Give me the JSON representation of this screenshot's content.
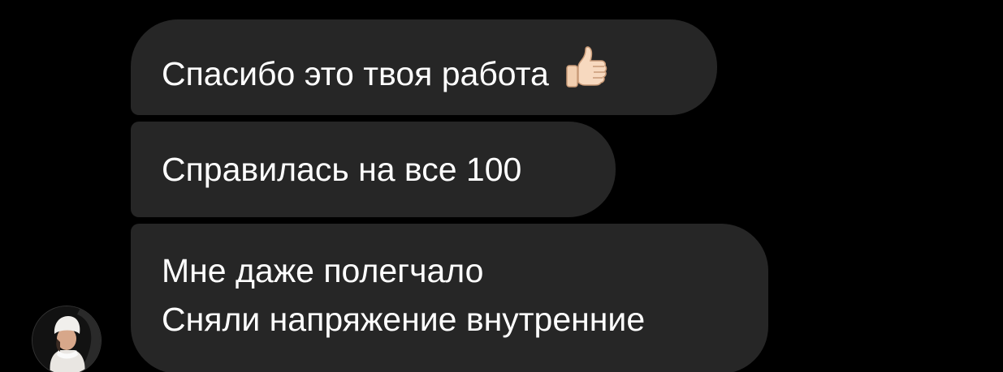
{
  "messages": [
    {
      "text": "Спасибо это твоя работа",
      "emoji": "thumbs-up-icon"
    },
    {
      "text": "Справилась на все 100"
    },
    {
      "lines": [
        "Мне даже полегчало",
        "Сняли напряжение внутренние"
      ]
    }
  ],
  "colors": {
    "background": "#000000",
    "bubble": "#262626",
    "text": "#ffffff"
  }
}
